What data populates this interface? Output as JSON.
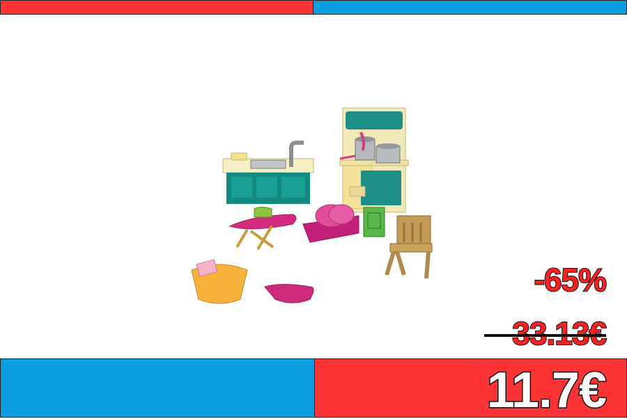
{
  "banner": {
    "colors": {
      "red": "#fe3336",
      "blue": "#0b9ede"
    }
  },
  "product": {
    "image_icon": "toy-kitchen-playset-image"
  },
  "pricing": {
    "discount": "-65%",
    "old_price": "33.13€",
    "new_price": "11.7€"
  }
}
